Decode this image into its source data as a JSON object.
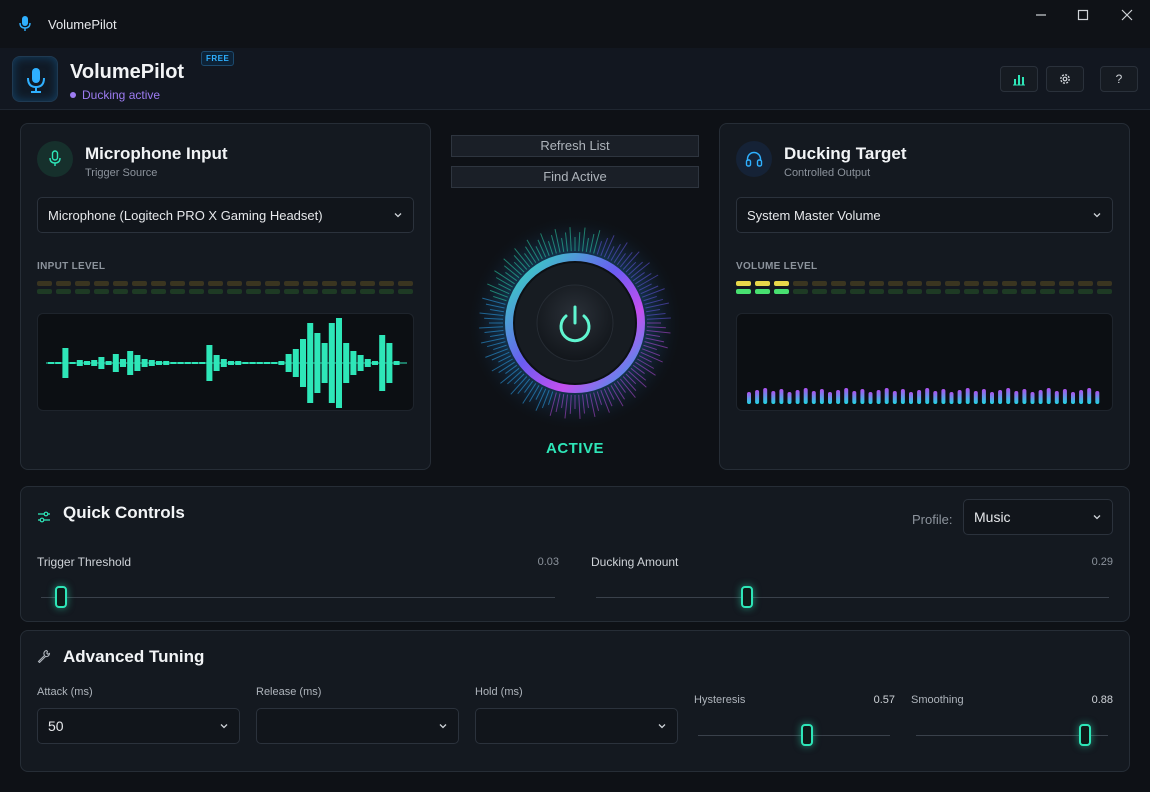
{
  "window": {
    "title": "VolumePilot",
    "controls": [
      "minimize",
      "maximize",
      "close"
    ]
  },
  "header": {
    "app_name": "VolumePilot",
    "badge": "FREE",
    "status": "Ducking active",
    "buttons": [
      {
        "name": "stats",
        "icon": "bar-chart-icon"
      },
      {
        "name": "settings",
        "icon": "gear-icon"
      },
      {
        "name": "help",
        "icon": "help-icon",
        "label": "?"
      }
    ]
  },
  "mic_panel": {
    "title": "Microphone Input",
    "subtitle": "Trigger Source",
    "device": "Microphone (Logitech PRO X Gaming Headset)",
    "level_label": "INPUT LEVEL",
    "level_active_segments": 0,
    "total_segments": 20
  },
  "center": {
    "refresh_label": "Refresh List",
    "find_label": "Find Active",
    "state_label": "ACTIVE",
    "power_icon": "power-icon"
  },
  "target_panel": {
    "title": "Ducking Target",
    "subtitle": "Controlled Output",
    "device": "System Master Volume",
    "level_label": "VOLUME LEVEL",
    "level_active_segments": 3,
    "total_segments": 20
  },
  "quick_controls": {
    "title": "Quick Controls",
    "profile_label": "Profile:",
    "profile_value": "Music",
    "threshold_label": "Trigger Threshold",
    "threshold_value": "0.03",
    "ducking_label": "Ducking Amount",
    "ducking_value": "0.29"
  },
  "advanced": {
    "title": "Advanced Tuning",
    "attack_label": "Attack (ms)",
    "attack_value": "50",
    "release_label": "Release (ms)",
    "release_value": "",
    "hold_label": "Hold (ms)",
    "hold_value": "",
    "hysteresis_label": "Hysteresis",
    "hysteresis_value": "0.57",
    "smoothing_label": "Smoothing",
    "smoothing_value": "0.88"
  },
  "colors": {
    "accent": "#2ee6b8",
    "purple": "#9d7cf2",
    "bg": "#0e1116"
  }
}
